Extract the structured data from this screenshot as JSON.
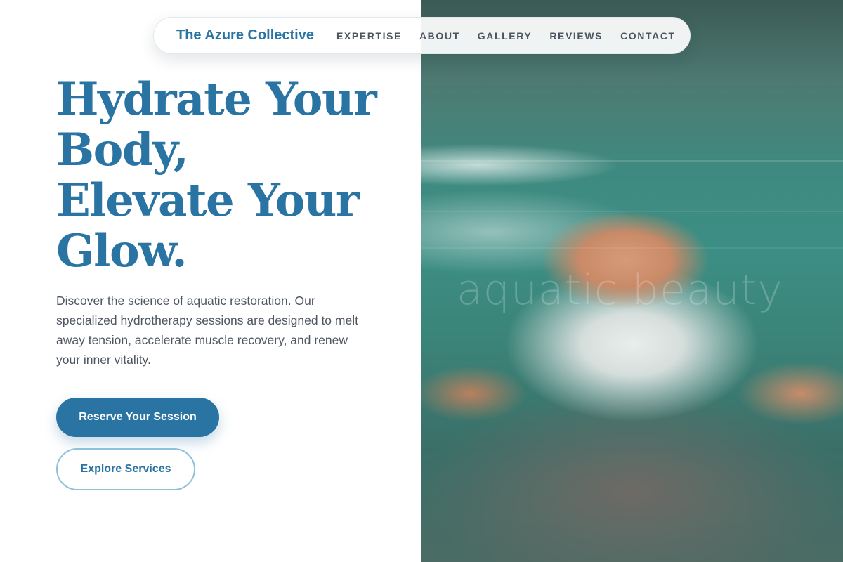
{
  "nav": {
    "brand": "The Azure Collective",
    "links": [
      "EXPERTISE",
      "ABOUT",
      "GALLERY",
      "REVIEWS",
      "CONTACT"
    ]
  },
  "hero": {
    "headline_lines": [
      "Hydrate Your",
      "Body,",
      "Elevate Your",
      "Glow."
    ],
    "lead": "Discover the science of aquatic restoration. Our specialized hydrotherapy sessions are designed to melt away tension, accelerate muscle recovery, and renew your inner vitality.",
    "primary_cta": "Reserve Your Session",
    "secondary_cta": "Explore Services",
    "image_watermark": "aquatic beauty"
  },
  "colors": {
    "accent": "#2a74a4",
    "text_body": "#4d5661",
    "outline": "#8fc1db",
    "water": "#3b8a80"
  }
}
